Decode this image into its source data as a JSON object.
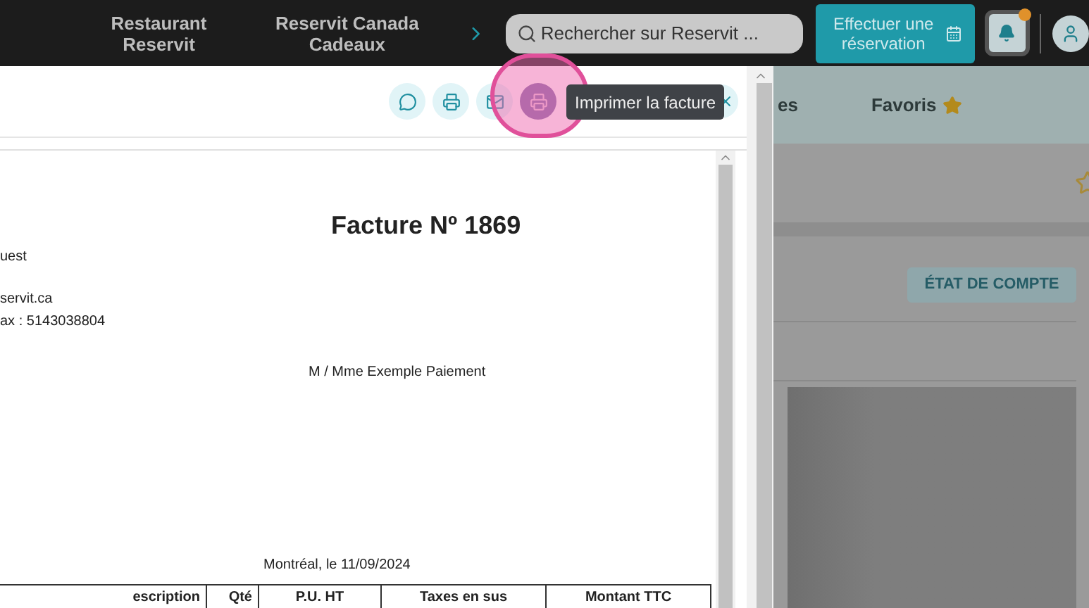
{
  "nav": {
    "items": [
      "Restaurant Reservit",
      "Reservit Canada Cadeaux"
    ],
    "search": {
      "placeholder": "Rechercher sur Reservit ..."
    },
    "book_button": "Effectuer une réservation",
    "notifications": {
      "unread": true
    }
  },
  "background": {
    "tabs": [
      "es",
      "Favoris"
    ],
    "account_button": "ÉTAT DE COMPTE"
  },
  "modal": {
    "actions": [
      {
        "kind": "comment",
        "highlighted": false
      },
      {
        "kind": "print",
        "highlighted": false
      },
      {
        "kind": "email",
        "highlighted": false
      },
      {
        "kind": "print",
        "highlighted": true
      }
    ],
    "tooltip": "Imprimer la facture",
    "document": {
      "title": "Facture Nº 1869",
      "sender": [
        [
          "uest"
        ],
        [
          "servit.ca",
          "ax : 5143038804"
        ]
      ],
      "recipient": "M / Mme Exemple Paiement",
      "date": "Montréal, le 11/09/2024",
      "table": {
        "columns": [
          "escription",
          "Qté",
          "P.U. HT",
          "Taxes en sus",
          "Montant TTC"
        ]
      }
    }
  }
}
